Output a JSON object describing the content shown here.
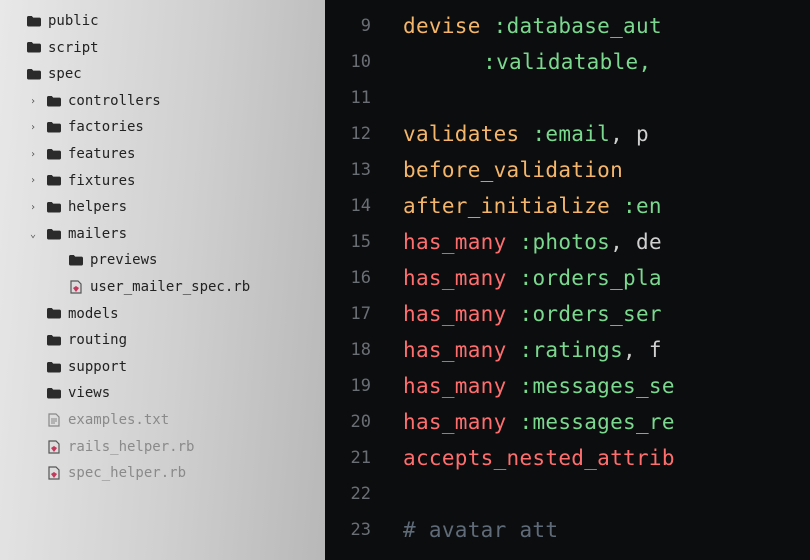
{
  "sidebar": {
    "items": [
      {
        "depth": 0,
        "chevron": "",
        "icon": "folder-open",
        "label": "public",
        "muted": false
      },
      {
        "depth": 0,
        "chevron": "",
        "icon": "folder",
        "label": "script",
        "muted": false
      },
      {
        "depth": 0,
        "chevron": "",
        "icon": "folder",
        "label": "spec",
        "muted": false
      },
      {
        "depth": 1,
        "chevron": "›",
        "icon": "folder",
        "label": "controllers",
        "muted": false
      },
      {
        "depth": 1,
        "chevron": "›",
        "icon": "folder",
        "label": "factories",
        "muted": false
      },
      {
        "depth": 1,
        "chevron": "›",
        "icon": "folder",
        "label": "features",
        "muted": false
      },
      {
        "depth": 1,
        "chevron": "›",
        "icon": "folder",
        "label": "fixtures",
        "muted": false
      },
      {
        "depth": 1,
        "chevron": "›",
        "icon": "folder",
        "label": "helpers",
        "muted": false
      },
      {
        "depth": 1,
        "chevron": "⌄",
        "icon": "folder",
        "label": "mailers",
        "muted": false
      },
      {
        "depth": 2,
        "chevron": "",
        "icon": "folder",
        "label": "previews",
        "muted": false
      },
      {
        "depth": 2,
        "chevron": "",
        "icon": "ruby-file",
        "label": "user_mailer_spec.rb",
        "muted": false
      },
      {
        "depth": 1,
        "chevron": "",
        "icon": "folder",
        "label": "models",
        "muted": false
      },
      {
        "depth": 1,
        "chevron": "",
        "icon": "folder",
        "label": "routing",
        "muted": false
      },
      {
        "depth": 1,
        "chevron": "",
        "icon": "folder",
        "label": "support",
        "muted": false
      },
      {
        "depth": 1,
        "chevron": "",
        "icon": "folder",
        "label": "views",
        "muted": false
      },
      {
        "depth": 1,
        "chevron": "",
        "icon": "text-file",
        "label": "examples.txt",
        "muted": true
      },
      {
        "depth": 1,
        "chevron": "",
        "icon": "ruby-file",
        "label": "rails_helper.rb",
        "muted": true
      },
      {
        "depth": 1,
        "chevron": "",
        "icon": "ruby-file",
        "label": "spec_helper.rb",
        "muted": true
      }
    ]
  },
  "editor": {
    "first_line_no": 9,
    "lines": [
      [
        {
          "cls": "kw2",
          "txt": "devise"
        },
        {
          "cls": "punct",
          "txt": " "
        },
        {
          "cls": "sym",
          "txt": ":database_aut"
        }
      ],
      [
        {
          "cls": "indent",
          "txt": ""
        },
        {
          "cls": "indent",
          "txt": ""
        },
        {
          "cls": "punct",
          "txt": "    "
        },
        {
          "cls": "sym",
          "txt": ":validatable,"
        }
      ],
      [
        {
          "cls": "",
          "txt": ""
        }
      ],
      [
        {
          "cls": "kw2",
          "txt": "validates"
        },
        {
          "cls": "punct",
          "txt": " "
        },
        {
          "cls": "sym",
          "txt": ":email"
        },
        {
          "cls": "punct",
          "txt": ", p"
        }
      ],
      [
        {
          "cls": "kw2",
          "txt": "before_validation"
        },
        {
          "cls": "punct",
          "txt": " "
        }
      ],
      [
        {
          "cls": "kw2",
          "txt": "after_initialize"
        },
        {
          "cls": "punct",
          "txt": " "
        },
        {
          "cls": "sym",
          "txt": ":en"
        }
      ],
      [
        {
          "cls": "kw",
          "txt": "has_many"
        },
        {
          "cls": "punct",
          "txt": " "
        },
        {
          "cls": "sym",
          "txt": ":photos"
        },
        {
          "cls": "punct",
          "txt": ", de"
        }
      ],
      [
        {
          "cls": "kw",
          "txt": "has_many"
        },
        {
          "cls": "punct",
          "txt": " "
        },
        {
          "cls": "sym",
          "txt": ":orders_pla"
        }
      ],
      [
        {
          "cls": "kw",
          "txt": "has_many"
        },
        {
          "cls": "punct",
          "txt": " "
        },
        {
          "cls": "sym",
          "txt": ":orders_ser"
        }
      ],
      [
        {
          "cls": "kw",
          "txt": "has_many"
        },
        {
          "cls": "punct",
          "txt": " "
        },
        {
          "cls": "sym",
          "txt": ":ratings"
        },
        {
          "cls": "punct",
          "txt": ", f"
        }
      ],
      [
        {
          "cls": "kw",
          "txt": "has_many"
        },
        {
          "cls": "punct",
          "txt": " "
        },
        {
          "cls": "sym",
          "txt": ":messages_se"
        }
      ],
      [
        {
          "cls": "kw",
          "txt": "has_many"
        },
        {
          "cls": "punct",
          "txt": " "
        },
        {
          "cls": "sym",
          "txt": ":messages_re"
        }
      ],
      [
        {
          "cls": "kw",
          "txt": "accepts_nested_attrib"
        }
      ],
      [
        {
          "cls": "",
          "txt": ""
        }
      ],
      [
        {
          "cls": "cmnt",
          "txt": "# avatar att"
        }
      ]
    ]
  }
}
